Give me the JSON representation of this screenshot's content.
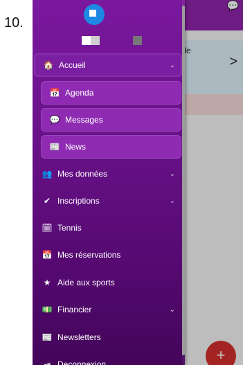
{
  "step_number": "10.",
  "background": {
    "card_text": "lle de",
    "card_chevron": ">",
    "fab_label": "+"
  },
  "drawer": {
    "items": [
      {
        "label": "Accueil",
        "icon": "home-icon",
        "glyph": "🏠",
        "chevron": "⌄"
      },
      {
        "label": "Agenda",
        "icon": "calendar-icon",
        "glyph": "📅"
      },
      {
        "label": "Messages",
        "icon": "comments-icon",
        "glyph": "💬"
      },
      {
        "label": "News",
        "icon": "newspaper-icon",
        "glyph": "📰"
      },
      {
        "label": "Mes données",
        "icon": "users-icon",
        "glyph": "👥",
        "chevron": "⌄"
      },
      {
        "label": "Inscriptions",
        "icon": "check-icon",
        "glyph": "✔",
        "chevron": "⌄"
      },
      {
        "label": "Tennis",
        "icon": "calendar-check-icon",
        "glyph": "🗓"
      },
      {
        "label": "Mes réservations",
        "icon": "calendar-icon",
        "glyph": "📅"
      },
      {
        "label": "Aide aux sports",
        "icon": "star-icon",
        "glyph": "★"
      },
      {
        "label": "Financier",
        "icon": "money-icon",
        "glyph": "💵",
        "chevron": "⌄"
      },
      {
        "label": "Newsletters",
        "icon": "newspaper-icon",
        "glyph": "📰"
      },
      {
        "label": "Deconnexion",
        "icon": "sign-out-icon",
        "glyph": "⇥"
      }
    ]
  },
  "colors": {
    "drawer_top": "#7a189e",
    "drawer_bottom": "#43055a",
    "topbar": "#8e24aa",
    "fab": "#d32f2f",
    "logo": "#1e88e5"
  }
}
